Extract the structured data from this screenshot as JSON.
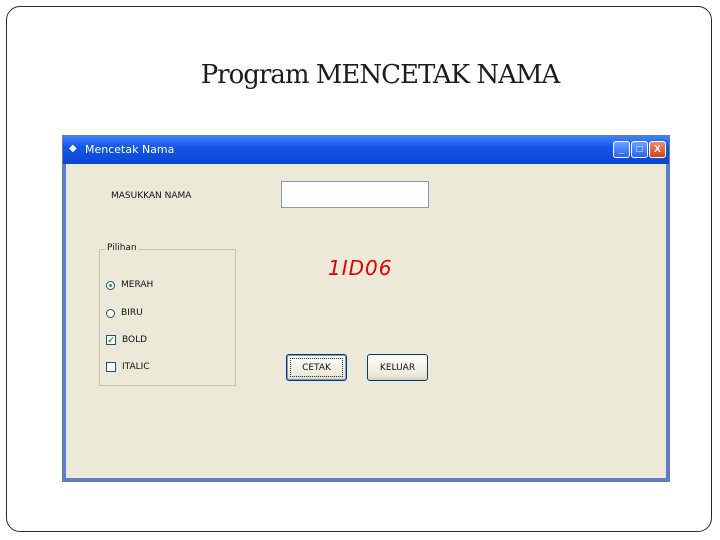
{
  "slide": {
    "title": "Program MENCETAK NAMA"
  },
  "window": {
    "title": "Mencetak Nama",
    "controls": {
      "minimize": "_",
      "maximize": "□",
      "close": "X"
    }
  },
  "form": {
    "name_label": "MASUKKAN NAMA",
    "name_input_value": "",
    "group_caption": "Pilihan",
    "options": [
      {
        "type": "radio",
        "label": "MERAH",
        "checked": true
      },
      {
        "type": "radio",
        "label": "BIRU",
        "checked": false
      },
      {
        "type": "checkbox",
        "label": "BOLD",
        "checked": true
      },
      {
        "type": "checkbox",
        "label": "ITALIC",
        "checked": false
      }
    ],
    "output_text": "1ID06",
    "output_color": "#e00000",
    "print_button": "CETAK",
    "exit_button": "KELUAR"
  },
  "icons": {
    "app_icon": "app-icon",
    "check_mark": "✓"
  }
}
